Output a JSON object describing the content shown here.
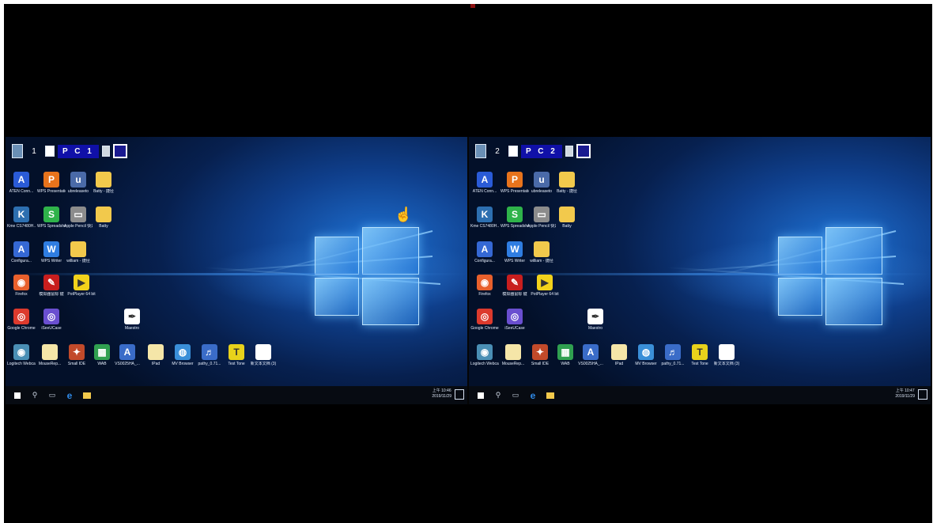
{
  "screens": [
    {
      "kvm_number": "1",
      "kvm_label": "P C  1",
      "clock_time": "上午 10:46",
      "clock_date": "2019/11/29"
    },
    {
      "kvm_number": "2",
      "kvm_label": "P C  2",
      "clock_time": "上午 10:47",
      "clock_date": "2019/11/29"
    }
  ],
  "desktop_icons": [
    {
      "label": "ATEN Conn...",
      "icon": "aten-icon",
      "color": "#2a5bd7",
      "glyph": "A"
    },
    {
      "label": "WPS Presentation",
      "icon": "wps-presentation-icon",
      "color": "#e8731c",
      "glyph": "P"
    },
    {
      "label": "ubreleaseto",
      "icon": "ubrelease-icon",
      "color": "#4a6aa8",
      "glyph": "u"
    },
    {
      "label": "Batty - 捷径",
      "icon": "folder-icon",
      "color": "#f2c94c",
      "glyph": ""
    },
    {
      "label": "Kme CS7480H...",
      "icon": "kme-icon",
      "color": "#2d6fb0",
      "glyph": "K"
    },
    {
      "label": "WPS Spreadshe...",
      "icon": "wps-spreadsheet-icon",
      "color": "#2fb34a",
      "glyph": "S"
    },
    {
      "label": "Apple Pencil 快速打开 ...",
      "icon": "apple-pencil-icon",
      "color": "#8c8c8c",
      "glyph": "▭"
    },
    {
      "label": "Batty",
      "icon": "folder-icon",
      "color": "#f2c94c",
      "glyph": ""
    },
    {
      "label": "Configura...",
      "icon": "configuration-icon",
      "color": "#3568d4",
      "glyph": "A"
    },
    {
      "label": "WPS Writer",
      "icon": "wps-writer-icon",
      "color": "#2f7de1",
      "glyph": "W"
    },
    {
      "label": "william - 捷径",
      "icon": "folder-icon",
      "color": "#f2c94c",
      "glyph": ""
    },
    {
      "label": "Firefox",
      "icon": "firefox-icon",
      "color": "#e8602c",
      "glyph": "◉"
    },
    {
      "label": "模拟器鼠标 键",
      "icon": "emulator-icon",
      "color": "#c81e1e",
      "glyph": "✎"
    },
    {
      "label": "PotPlayer 64 bit",
      "icon": "potplayer-icon",
      "color": "#f2d21b",
      "glyph": "▶"
    },
    {
      "label": "Google Chrome",
      "icon": "chrome-icon",
      "color": "#dc3a2d",
      "glyph": "◎"
    },
    {
      "label": "iSeeUCase",
      "icon": "iseeucase-icon",
      "color": "#6a4fd0",
      "glyph": "◎"
    },
    {
      "label": "Maestro",
      "icon": "maestro-icon",
      "color": "#ffffff",
      "glyph": "✒"
    },
    {
      "label": "Logitech Webca...",
      "icon": "webcam-icon",
      "color": "#4a8fb5",
      "glyph": "◉"
    },
    {
      "label": "MouseRep...",
      "icon": "file-icon",
      "color": "#f5e6a8",
      "glyph": ""
    },
    {
      "label": "Small IDE",
      "icon": "small-ide-icon",
      "color": "#c24a2a",
      "glyph": "✦"
    },
    {
      "label": "WAB",
      "icon": "wab-icon",
      "color": "#30a050",
      "glyph": "▦"
    },
    {
      "label": "VS0025HA_...",
      "icon": "vs-setup-icon",
      "color": "#3a6cc8",
      "glyph": "A"
    },
    {
      "label": "IPad",
      "icon": "file-icon",
      "color": "#f5e6a8",
      "glyph": ""
    },
    {
      "label": "MV Browser",
      "icon": "mv-browser-icon",
      "color": "#3a8fd8",
      "glyph": "◍"
    },
    {
      "label": "pathy_0.71...",
      "icon": "pathy-icon",
      "color": "#3a6cc8",
      "glyph": "♬"
    },
    {
      "label": "Test Tone",
      "icon": "test-tone-icon",
      "color": "#e8d21b",
      "glyph": "T"
    },
    {
      "label": "新文本文档 (3)",
      "icon": "text-document-icon",
      "color": "#ffffff",
      "glyph": ""
    }
  ],
  "taskbar": {
    "start": "start-icon",
    "search": "search-icon",
    "taskview": "task-view-icon",
    "edge": "edge-icon",
    "explorer": "file-explorer-icon",
    "tray_glyphs": "^ ◘ ◁) ⌨"
  }
}
